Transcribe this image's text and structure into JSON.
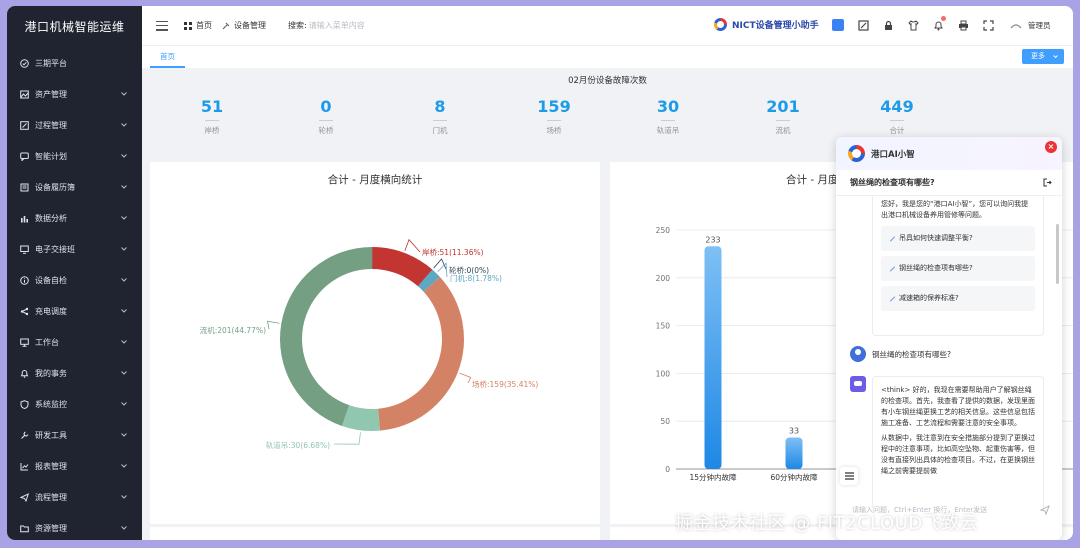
{
  "app": {
    "title": "港口机械智能运维"
  },
  "sidebar": {
    "items": [
      {
        "label": "三期平台",
        "icon": "check-circle-icon",
        "expandable": false
      },
      {
        "label": "资产管理",
        "icon": "image-icon",
        "expandable": true
      },
      {
        "label": "过程管理",
        "icon": "edit-icon",
        "expandable": true
      },
      {
        "label": "智能计划",
        "icon": "message-icon",
        "expandable": true
      },
      {
        "label": "设备履历簿",
        "icon": "book-icon",
        "expandable": true
      },
      {
        "label": "数据分析",
        "icon": "bar-chart-icon",
        "expandable": true
      },
      {
        "label": "电子交接班",
        "icon": "monitor-icon",
        "expandable": true
      },
      {
        "label": "设备自检",
        "icon": "info-icon",
        "expandable": true
      },
      {
        "label": "充电调度",
        "icon": "share-icon",
        "expandable": true
      },
      {
        "label": "工作台",
        "icon": "desktop-icon",
        "expandable": true
      },
      {
        "label": "我的事务",
        "icon": "bell-icon",
        "expandable": true
      },
      {
        "label": "系统监控",
        "icon": "shield-icon",
        "expandable": true
      },
      {
        "label": "研发工具",
        "icon": "wrench-icon",
        "expandable": true
      },
      {
        "label": "报表管理",
        "icon": "chart-icon",
        "expandable": true
      },
      {
        "label": "流程管理",
        "icon": "send-icon",
        "expandable": true
      },
      {
        "label": "资源管理",
        "icon": "folder-icon",
        "expandable": true
      }
    ]
  },
  "header": {
    "breadcrumb": [
      {
        "label": "首页"
      },
      {
        "label": "设备管理"
      }
    ],
    "search_label": "搜索:",
    "search_placeholder": "请输入菜单内容",
    "assistant_label": "NICT设备管理小助手",
    "user_label": "管理员"
  },
  "tabs": {
    "active": "首页",
    "more_label": "更多"
  },
  "stats": {
    "title": "02月份设备故障次数",
    "items": [
      {
        "value": "51",
        "label": "岸桥"
      },
      {
        "value": "0",
        "label": "轮桥"
      },
      {
        "value": "8",
        "label": "门机"
      },
      {
        "value": "159",
        "label": "场桥"
      },
      {
        "value": "30",
        "label": "轨道吊"
      },
      {
        "value": "201",
        "label": "流机"
      },
      {
        "value": "449",
        "label": "合计"
      }
    ]
  },
  "colors": {
    "accent": "#409eff",
    "number": "#1e9be8",
    "sidebar": "#1f2430"
  },
  "chart_data": [
    {
      "type": "pie",
      "title": "合计 - 月度横向统计",
      "slices": [
        {
          "name": "岸桥",
          "value": 51,
          "label": "岸桥:51(11.36%)",
          "color": "#c23531"
        },
        {
          "name": "轮桥",
          "value": 0,
          "label": "轮桥:0(0%)",
          "color": "#2f4554"
        },
        {
          "name": "门机",
          "value": 8,
          "label": "门机:8(1.78%)",
          "color": "#5fa8c4"
        },
        {
          "name": "场桥",
          "value": 159,
          "label": "场桥:159(35.41%)",
          "color": "#d48265"
        },
        {
          "name": "轨道吊",
          "value": 30,
          "label": "轨道吊:30(6.68%)",
          "color": "#91c7ae"
        },
        {
          "name": "流机",
          "value": 201,
          "label": "流机:201(44.77%)",
          "color": "#749f83"
        }
      ]
    },
    {
      "type": "bar",
      "title": "合计 - 月度",
      "categories": [
        "15分钟内故障",
        "60分钟内故障"
      ],
      "values": [
        233,
        33
      ],
      "ylim": [
        0,
        250
      ],
      "yticks": [
        "0",
        "50",
        "100",
        "150",
        "200",
        "250"
      ]
    }
  ],
  "chat": {
    "title": "港口AI小智",
    "question": "钢丝绳的检查项有哪些?",
    "intro_text": "您好，我是您的“港口AI小智”，您可以询问我提出港口机械设备养用管修等问题。",
    "suggestions": [
      "吊具如何快速调整平衡?",
      "钢丝绳的检查项有哪些?",
      "减速箱的保养标准?"
    ],
    "user_message": "钢丝绳的检查项有哪些?",
    "answer_p1": "<think> 好的，我现在需要帮助用户了解钢丝绳的检查项。首先，我查看了提供的数据，发现里面有小车钢丝绳更换工艺的相关信息。这些信息包括施工准备、工艺流程和需要注意的安全事项。",
    "answer_p2": "从数据中，我注意到在安全措施部分提到了更换过程中的注意事项，比如高空坠物、起重伤害等，但没有直接列出具体的检查项目。不过，在更换钢丝绳之前需要提前做",
    "input_placeholder": "请输入问题，Ctrl+Enter 换行，Enter发送"
  },
  "watermark": "掘金技术社区 @ FIT2CLOUD飞致云"
}
